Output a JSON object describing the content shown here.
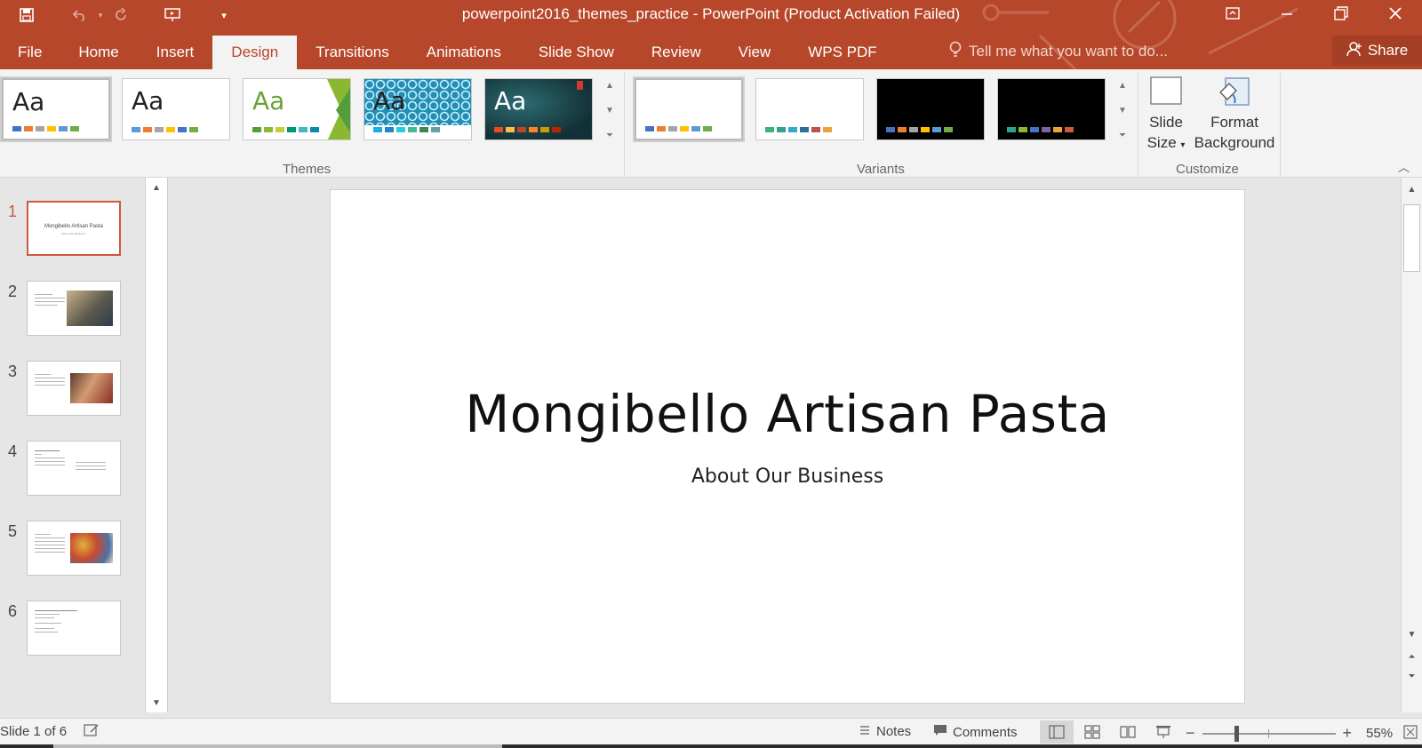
{
  "window": {
    "title": "powerpoint2016_themes_practice - PowerPoint (Product Activation Failed)",
    "accent_color": "#b7472a"
  },
  "quick_access": {
    "icons": [
      "save-icon",
      "undo-icon",
      "redo-icon",
      "present-icon",
      "customize-icon"
    ]
  },
  "tabs": [
    {
      "label": "File"
    },
    {
      "label": "Home"
    },
    {
      "label": "Insert"
    },
    {
      "label": "Design",
      "active": true
    },
    {
      "label": "Transitions"
    },
    {
      "label": "Animations"
    },
    {
      "label": "Slide Show"
    },
    {
      "label": "Review"
    },
    {
      "label": "View"
    },
    {
      "label": "WPS PDF"
    }
  ],
  "tell_me": {
    "placeholder": "Tell me what you want to do..."
  },
  "share": {
    "label": "Share"
  },
  "ribbon": {
    "themes": {
      "label": "Themes",
      "tiles": [
        {
          "glyph": "Aa",
          "colors": [
            "#4472c4",
            "#ed7d31",
            "#a5a5a5",
            "#ffc000",
            "#5b9bd5",
            "#70ad47"
          ],
          "selected": true
        },
        {
          "glyph": "Aa",
          "colors": [
            "#5b9bd5",
            "#ed7d31",
            "#a5a5a5",
            "#ffc000",
            "#4472c4",
            "#70ad47"
          ]
        },
        {
          "glyph": "Aa",
          "colors": [
            "#549e39",
            "#8ab833",
            "#c0cf3a",
            "#029676",
            "#4ab5c4",
            "#0989b1"
          ]
        },
        {
          "glyph": "Aa",
          "colors": [
            "#1cade4",
            "#2683c6",
            "#27ced7",
            "#42ba97",
            "#3e8853",
            "#62a39f"
          ]
        },
        {
          "glyph": "Aa",
          "colors": [
            "#e84c22",
            "#ffbd47",
            "#b64926",
            "#ff8427",
            "#cc9900",
            "#b22600"
          ]
        }
      ]
    },
    "variants": {
      "label": "Variants",
      "tiles": [
        {
          "colors": [
            "#4472c4",
            "#ed7d31",
            "#a5a5a5",
            "#ffc000",
            "#5b9bd5",
            "#70ad47"
          ]
        },
        {
          "colors": [
            "#3cb371",
            "#2ca58d",
            "#31a9c7",
            "#2c6e9e",
            "#c0504d",
            "#e8a33b"
          ]
        },
        {
          "colors": [
            "#4472c4",
            "#ed7d31",
            "#a5a5a5",
            "#ffc000",
            "#5b9bd5",
            "#70ad47"
          ]
        },
        {
          "colors": [
            "#2ca58d",
            "#8ab833",
            "#4472c4",
            "#8064a2",
            "#e8a33b",
            "#d0583c"
          ]
        }
      ]
    },
    "customize": {
      "label": "Customize",
      "slide_size": {
        "line1": "Slide",
        "line2": "Size"
      },
      "format_background": {
        "line1": "Format",
        "line2": "Background"
      }
    }
  },
  "slides": [
    {
      "number": "1",
      "title": "Mongibello Artisan Pasta",
      "subtitle": "About Our Business",
      "active": true
    },
    {
      "number": "2"
    },
    {
      "number": "3"
    },
    {
      "number": "4"
    },
    {
      "number": "5"
    },
    {
      "number": "6"
    }
  ],
  "current_slide": {
    "title": "Mongibello Artisan Pasta",
    "subtitle": "About Our Business"
  },
  "status": {
    "slide_info": "Slide 1 of 6",
    "notes_label": "Notes",
    "comments_label": "Comments",
    "zoom": "55%"
  }
}
